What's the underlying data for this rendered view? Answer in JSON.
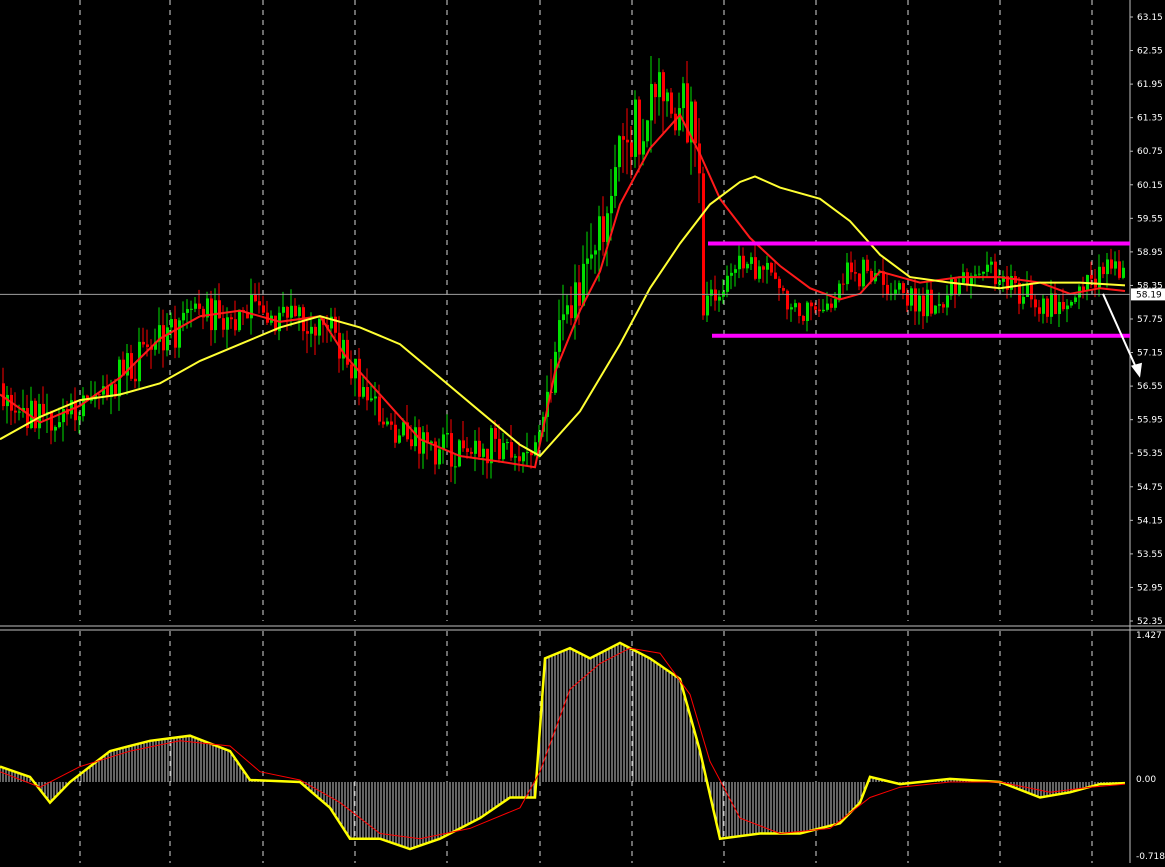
{
  "colors": {
    "background": "#000000",
    "grid": "#ffffff",
    "bull_candle": "#00e000",
    "bear_candle": "#ff0000",
    "ma_fast": "#ff1a1a",
    "ma_slow": "#ffff33",
    "range_lines": "#ff00ff",
    "histogram": "#c8c8c8",
    "osc_line": "#ffff00",
    "signal_line": "#ff0000",
    "arrow": "#ffffff",
    "current_price_line": "#a0a0a0",
    "price_tag_bg": "#ffffff",
    "price_tag_text": "#000000"
  },
  "chart_data": [
    {
      "type": "candlestick",
      "grid": true,
      "y_range": [
        52.35,
        63.15
      ],
      "tick_labels": [
        "63.15",
        "62.55",
        "61.95",
        "61.35",
        "60.75",
        "60.15",
        "59.55",
        "58.95",
        "58.35",
        "57.75",
        "57.15",
        "56.55",
        "55.95",
        "55.35",
        "54.75",
        "54.15",
        "53.55",
        "52.95",
        "52.35"
      ],
      "current_price": "58.19",
      "range_lines": [
        59.1,
        57.45
      ],
      "arrow": {
        "from_x": 1103,
        "from_y": 58.2,
        "to_x": 1140,
        "to_y": 56.7
      },
      "series": [
        {
          "name": "",
          "kind": "ma_fast",
          "points": [
            [
              0,
              56.4
            ],
            [
              40,
              55.9
            ],
            [
              80,
              56.2
            ],
            [
              120,
              56.7
            ],
            [
              160,
              57.4
            ],
            [
              200,
              57.8
            ],
            [
              240,
              57.9
            ],
            [
              280,
              57.7
            ],
            [
              320,
              57.8
            ],
            [
              345,
              57.1
            ],
            [
              380,
              56.4
            ],
            [
              420,
              55.6
            ],
            [
              460,
              55.3
            ],
            [
              500,
              55.2
            ],
            [
              535,
              55.1
            ],
            [
              555,
              56.8
            ],
            [
              580,
              57.9
            ],
            [
              600,
              58.6
            ],
            [
              620,
              59.8
            ],
            [
              650,
              60.8
            ],
            [
              680,
              61.4
            ],
            [
              700,
              60.7
            ],
            [
              720,
              59.9
            ],
            [
              750,
              59.2
            ],
            [
              780,
              58.7
            ],
            [
              810,
              58.3
            ],
            [
              840,
              58.1
            ],
            [
              860,
              58.2
            ],
            [
              880,
              58.6
            ],
            [
              920,
              58.4
            ],
            [
              960,
              58.5
            ],
            [
              1000,
              58.5
            ],
            [
              1040,
              58.4
            ],
            [
              1070,
              58.2
            ],
            [
              1100,
              58.3
            ],
            [
              1125,
              58.25
            ]
          ]
        },
        {
          "name": "",
          "kind": "ma_slow",
          "points": [
            [
              0,
              55.6
            ],
            [
              40,
              56.0
            ],
            [
              80,
              56.3
            ],
            [
              120,
              56.4
            ],
            [
              160,
              56.6
            ],
            [
              200,
              57.0
            ],
            [
              240,
              57.3
            ],
            [
              280,
              57.6
            ],
            [
              320,
              57.8
            ],
            [
              360,
              57.6
            ],
            [
              400,
              57.3
            ],
            [
              440,
              56.7
            ],
            [
              480,
              56.1
            ],
            [
              520,
              55.5
            ],
            [
              540,
              55.3
            ],
            [
              580,
              56.1
            ],
            [
              620,
              57.3
            ],
            [
              650,
              58.3
            ],
            [
              680,
              59.1
            ],
            [
              710,
              59.8
            ],
            [
              740,
              60.2
            ],
            [
              755,
              60.3
            ],
            [
              780,
              60.1
            ],
            [
              820,
              59.9
            ],
            [
              850,
              59.5
            ],
            [
              880,
              58.9
            ],
            [
              910,
              58.5
            ],
            [
              950,
              58.4
            ],
            [
              1000,
              58.3
            ],
            [
              1040,
              58.4
            ],
            [
              1080,
              58.4
            ],
            [
              1125,
              58.35
            ]
          ]
        }
      ]
    },
    {
      "type": "histogram",
      "y_range": [
        -0.718,
        1.427
      ],
      "tick_labels": [
        "1.427",
        "0.00",
        "-0.718"
      ],
      "histogram": [
        [
          0,
          0.15
        ],
        [
          30,
          0.05
        ],
        [
          50,
          -0.2
        ],
        [
          70,
          0.0
        ],
        [
          110,
          0.3
        ],
        [
          150,
          0.4
        ],
        [
          190,
          0.45
        ],
        [
          230,
          0.3
        ],
        [
          250,
          0.02
        ],
        [
          300,
          0.0
        ],
        [
          330,
          -0.25
        ],
        [
          350,
          -0.55
        ],
        [
          380,
          -0.55
        ],
        [
          410,
          -0.65
        ],
        [
          440,
          -0.55
        ],
        [
          480,
          -0.35
        ],
        [
          510,
          -0.15
        ],
        [
          535,
          -0.15
        ],
        [
          545,
          1.2
        ],
        [
          570,
          1.3
        ],
        [
          590,
          1.2
        ],
        [
          620,
          1.35
        ],
        [
          650,
          1.2
        ],
        [
          680,
          1.0
        ],
        [
          700,
          0.3
        ],
        [
          720,
          -0.55
        ],
        [
          760,
          -0.5
        ],
        [
          800,
          -0.5
        ],
        [
          840,
          -0.4
        ],
        [
          860,
          -0.2
        ],
        [
          870,
          0.05
        ],
        [
          900,
          -0.02
        ],
        [
          950,
          0.03
        ],
        [
          1000,
          0.0
        ],
        [
          1040,
          -0.15
        ],
        [
          1070,
          -0.1
        ],
        [
          1100,
          -0.02
        ],
        [
          1125,
          -0.01
        ]
      ],
      "signal": [
        [
          0,
          0.1
        ],
        [
          40,
          -0.05
        ],
        [
          80,
          0.15
        ],
        [
          130,
          0.3
        ],
        [
          180,
          0.4
        ],
        [
          230,
          0.35
        ],
        [
          260,
          0.1
        ],
        [
          300,
          0.02
        ],
        [
          340,
          -0.2
        ],
        [
          380,
          -0.5
        ],
        [
          420,
          -0.55
        ],
        [
          470,
          -0.45
        ],
        [
          520,
          -0.25
        ],
        [
          540,
          0.1
        ],
        [
          570,
          0.9
        ],
        [
          600,
          1.15
        ],
        [
          630,
          1.3
        ],
        [
          660,
          1.25
        ],
        [
          690,
          0.85
        ],
        [
          710,
          0.2
        ],
        [
          740,
          -0.35
        ],
        [
          780,
          -0.5
        ],
        [
          830,
          -0.45
        ],
        [
          870,
          -0.15
        ],
        [
          900,
          -0.05
        ],
        [
          950,
          0.0
        ],
        [
          1000,
          0.0
        ],
        [
          1050,
          -0.1
        ],
        [
          1090,
          -0.05
        ],
        [
          1125,
          -0.02
        ]
      ]
    }
  ]
}
